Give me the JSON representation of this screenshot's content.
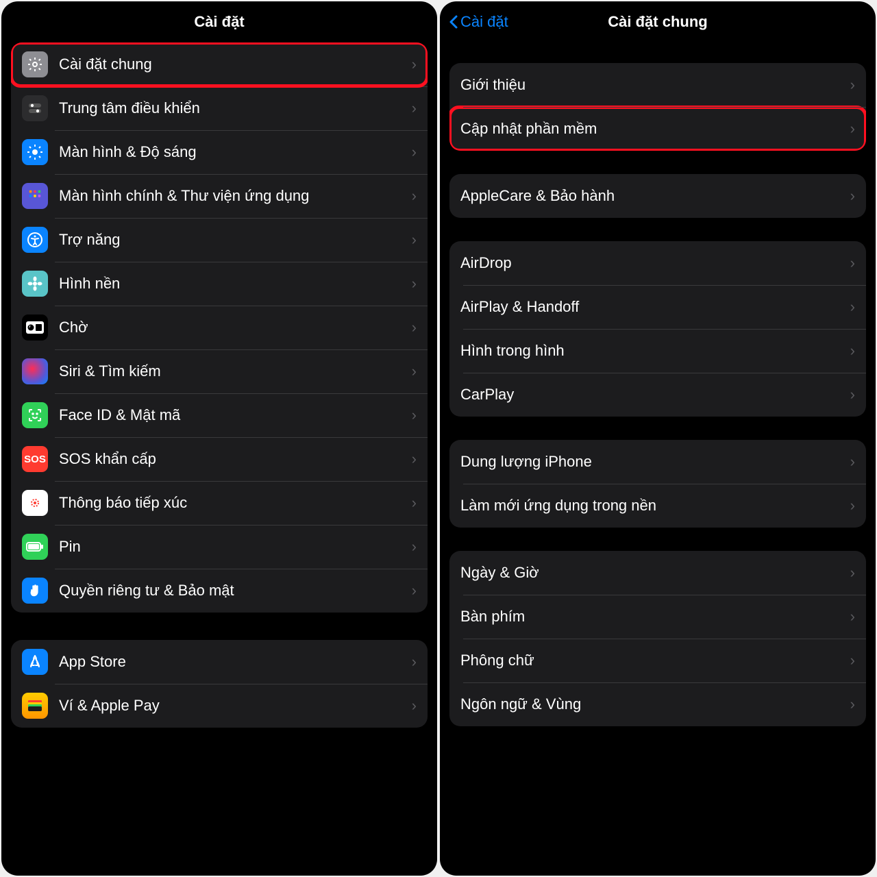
{
  "left": {
    "title": "Cài đặt",
    "group1": [
      {
        "key": "general",
        "label": "Cài đặt chung",
        "icon": "gear-icon",
        "highlight": true
      },
      {
        "key": "control",
        "label": "Trung tâm điều khiển",
        "icon": "toggles-icon"
      },
      {
        "key": "display",
        "label": "Màn hình & Độ sáng",
        "icon": "brightness-icon"
      },
      {
        "key": "home",
        "label": "Màn hình chính & Thư viện ứng dụng",
        "icon": "apps-grid-icon"
      },
      {
        "key": "access",
        "label": "Trợ năng",
        "icon": "accessibility-icon"
      },
      {
        "key": "wall",
        "label": "Hình nền",
        "icon": "flower-icon"
      },
      {
        "key": "standby",
        "label": "Chờ",
        "icon": "standby-icon"
      },
      {
        "key": "siri",
        "label": "Siri & Tìm kiếm",
        "icon": "siri-icon"
      },
      {
        "key": "faceid",
        "label": "Face ID & Mật mã",
        "icon": "faceid-icon"
      },
      {
        "key": "sos",
        "label": "SOS khẩn cấp",
        "icon": "sos-icon"
      },
      {
        "key": "exposure",
        "label": "Thông báo tiếp xúc",
        "icon": "exposure-icon"
      },
      {
        "key": "battery",
        "label": "Pin",
        "icon": "battery-icon"
      },
      {
        "key": "privacy",
        "label": "Quyền riêng tư & Bảo mật",
        "icon": "hand-icon"
      }
    ],
    "group2": [
      {
        "key": "appstore",
        "label": "App Store",
        "icon": "appstore-icon"
      },
      {
        "key": "wallet",
        "label": "Ví & Apple Pay",
        "icon": "wallet-icon"
      }
    ]
  },
  "right": {
    "back": "Cài đặt",
    "title": "Cài đặt chung",
    "group1": [
      {
        "key": "about",
        "label": "Giới thiệu"
      },
      {
        "key": "update",
        "label": "Cập nhật phần mềm",
        "highlight": true
      }
    ],
    "group2": [
      {
        "key": "applecare",
        "label": "AppleCare & Bảo hành"
      }
    ],
    "group3": [
      {
        "key": "airdrop",
        "label": "AirDrop"
      },
      {
        "key": "airplay",
        "label": "AirPlay & Handoff"
      },
      {
        "key": "pip",
        "label": "Hình trong hình"
      },
      {
        "key": "carplay",
        "label": "CarPlay"
      }
    ],
    "group4": [
      {
        "key": "storage",
        "label": "Dung lượng iPhone"
      },
      {
        "key": "bgapp",
        "label": "Làm mới ứng dụng trong nền"
      }
    ],
    "group5": [
      {
        "key": "datetime",
        "label": "Ngày & Giờ"
      },
      {
        "key": "keyboard",
        "label": "Bàn phím"
      },
      {
        "key": "fonts",
        "label": "Phông chữ"
      },
      {
        "key": "lang",
        "label": "Ngôn ngữ & Vùng"
      }
    ]
  }
}
